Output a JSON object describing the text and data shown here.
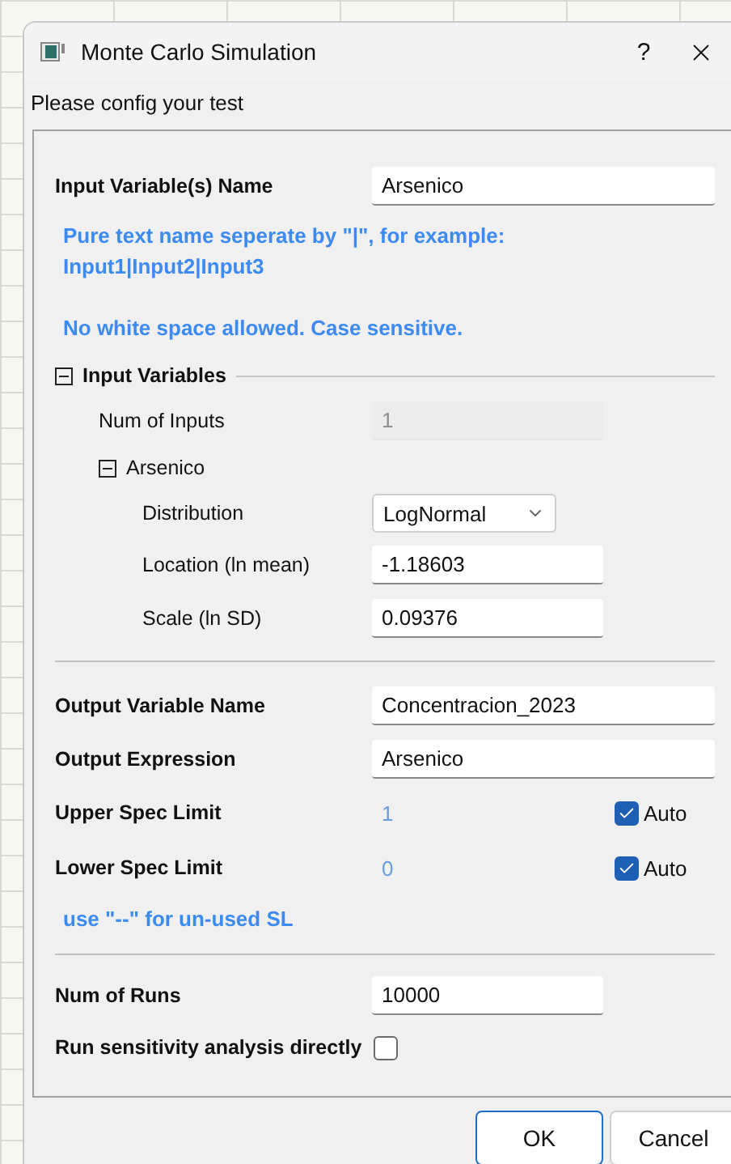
{
  "window": {
    "title": "Monte Carlo Simulation",
    "help": "?"
  },
  "prompt": "Please config your test",
  "input_name": {
    "label": "Input Variable(s) Name",
    "value": "Arsenico"
  },
  "hint_lines": [
    "Pure text name seperate by \"|\", for example:",
    "Input1|Input2|Input3"
  ],
  "hint_note": "No white space allowed. Case sensitive.",
  "input_variables": {
    "label": "Input Variables",
    "expanded": true,
    "num_of_inputs": {
      "label": "Num of Inputs",
      "value": "1",
      "disabled": true
    },
    "variables": [
      {
        "name": "Arsenico",
        "expanded": true,
        "fields": [
          {
            "kind": "dropdown",
            "label": "Distribution",
            "value": "LogNormal"
          },
          {
            "kind": "text",
            "label": "Location (ln mean)",
            "value": "-1.18603"
          },
          {
            "kind": "text",
            "label": "Scale (ln SD)",
            "value": "0.09376"
          }
        ]
      }
    ]
  },
  "output_variable": {
    "label": "Output Variable Name",
    "value": "Concentracion_2023"
  },
  "output_expression": {
    "label": "Output Expression",
    "value": "Arsenico"
  },
  "spec_limits": [
    {
      "label": "Upper Spec Limit",
      "value": "1",
      "auto_label": "Auto",
      "auto": true
    },
    {
      "label": "Lower Spec Limit",
      "value": "0",
      "auto_label": "Auto",
      "auto": true
    }
  ],
  "spec_note": "use \"--\" for un-used SL",
  "num_of_runs": {
    "label": "Num of Runs",
    "value": "10000"
  },
  "sensitivity": {
    "label": "Run sensitivity analysis directly",
    "checked": false
  },
  "buttons": [
    {
      "label": "OK",
      "default": true
    },
    {
      "label": "Cancel",
      "default": false
    }
  ]
}
